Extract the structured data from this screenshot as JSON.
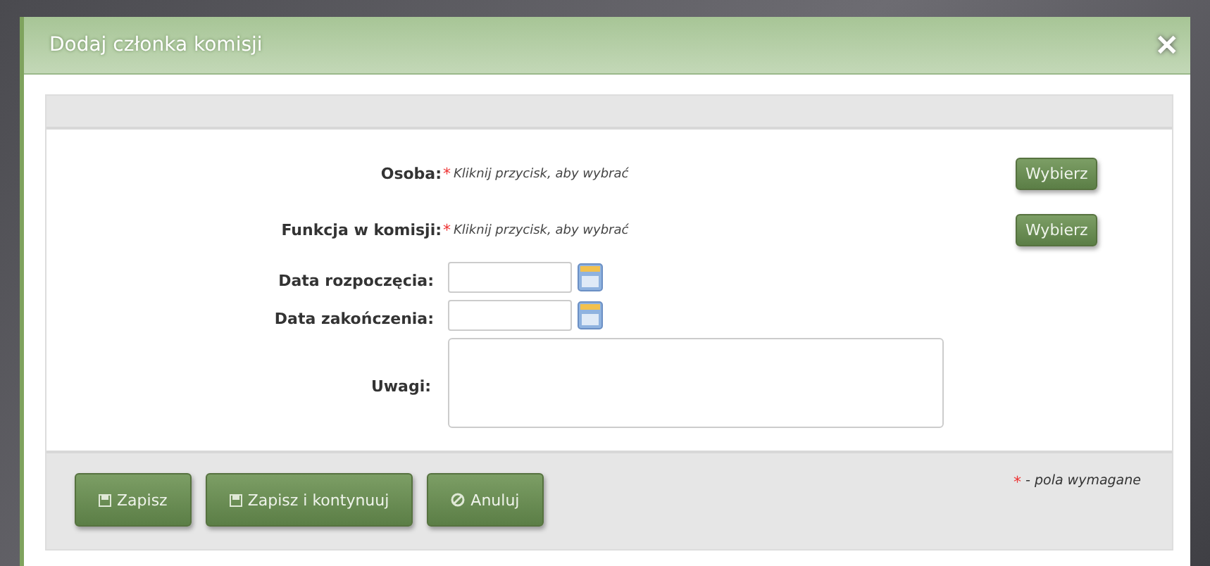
{
  "dialog": {
    "title": "Dodaj członka komisji",
    "close_label": "✕"
  },
  "required_mark": "*",
  "fields": [
    {
      "kind": "pick",
      "label": "Osoba:",
      "required": true,
      "hint": "Kliknij przycisk, aby wybrać",
      "button": "Wybierz"
    },
    {
      "kind": "pick",
      "label": "Funkcja w komisji:",
      "required": true,
      "hint": "Kliknij przycisk, aby wybrać",
      "button": "Wybierz"
    },
    {
      "kind": "date",
      "label": "Data rozpoczęcia:",
      "required": false
    },
    {
      "kind": "date",
      "label": "Data zakończenia:",
      "required": false
    },
    {
      "kind": "textarea",
      "label": "Uwagi:",
      "required": false
    }
  ],
  "actions": [
    {
      "kind": "save",
      "label": "Zapisz"
    },
    {
      "kind": "save",
      "label": "Zapisz i kontynuuj"
    },
    {
      "kind": "cancel",
      "label": "Anuluj"
    }
  ],
  "required_note": "- pola wymagane"
}
